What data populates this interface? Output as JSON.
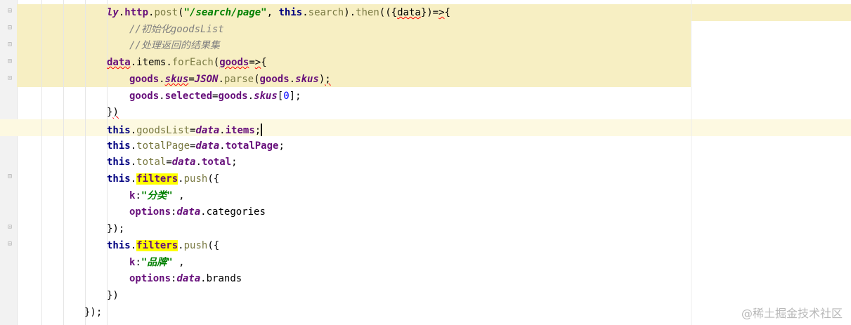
{
  "lines": [
    {
      "indent": 1,
      "tokens": [
        {
          "t": "ly",
          "c": "t-ital"
        },
        {
          "t": ".",
          "c": "t-plain"
        },
        {
          "t": "http",
          "c": "t-prop"
        },
        {
          "t": ".",
          "c": "t-plain"
        },
        {
          "t": "post",
          "c": "t-meth"
        },
        {
          "t": "(",
          "c": "t-plain"
        },
        {
          "t": "\"/search/page\"",
          "c": "t-str"
        },
        {
          "t": ", ",
          "c": "t-plain"
        },
        {
          "t": "this",
          "c": "t-kw"
        },
        {
          "t": ".",
          "c": "t-plain"
        },
        {
          "t": "search",
          "c": "t-meth"
        },
        {
          "t": ").",
          "c": "t-plain"
        },
        {
          "t": "then",
          "c": "t-meth"
        },
        {
          "t": "(({",
          "c": "t-plain"
        },
        {
          "t": "data",
          "c": "t-plain t-err"
        },
        {
          "t": "})=",
          "c": "t-plain"
        },
        {
          "t": ">",
          "c": "t-plain t-err"
        },
        {
          "t": "{",
          "c": "t-plain"
        }
      ]
    },
    {
      "indent": 2,
      "tokens": [
        {
          "t": "//初始化goodsList",
          "c": "t-cmt"
        }
      ]
    },
    {
      "indent": 2,
      "tokens": [
        {
          "t": "//处理返回的结果集",
          "c": "t-cmt"
        }
      ]
    },
    {
      "indent": 1,
      "tokens": [
        {
          "t": "data",
          "c": "t-prop t-err"
        },
        {
          "t": ".",
          "c": "t-plain"
        },
        {
          "t": "items",
          "c": "t-plain"
        },
        {
          "t": ".",
          "c": "t-plain"
        },
        {
          "t": "forEach",
          "c": "t-meth"
        },
        {
          "t": "(",
          "c": "t-plain"
        },
        {
          "t": "goods",
          "c": "t-prop t-err"
        },
        {
          "t": "=",
          "c": "t-plain"
        },
        {
          "t": ">",
          "c": "t-plain t-err"
        },
        {
          "t": "{",
          "c": "t-plain"
        }
      ]
    },
    {
      "indent": 2,
      "tokens": [
        {
          "t": "goods",
          "c": "t-prop"
        },
        {
          "t": ".",
          "c": "t-plain"
        },
        {
          "t": "skus",
          "c": "t-propi t-err"
        },
        {
          "t": "=",
          "c": "t-plain"
        },
        {
          "t": "JSON",
          "c": "t-ital"
        },
        {
          "t": ".",
          "c": "t-plain"
        },
        {
          "t": "parse",
          "c": "t-meth"
        },
        {
          "t": "(",
          "c": "t-plain"
        },
        {
          "t": "goods",
          "c": "t-prop"
        },
        {
          "t": ".",
          "c": "t-plain"
        },
        {
          "t": "skus",
          "c": "t-propi"
        },
        {
          "t": ")",
          "c": "t-plain"
        },
        {
          "t": ";",
          "c": "t-plain t-err"
        }
      ]
    },
    {
      "indent": 2,
      "tokens": [
        {
          "t": "goods",
          "c": "t-prop"
        },
        {
          "t": ".",
          "c": "t-plain"
        },
        {
          "t": "selected",
          "c": "t-prop"
        },
        {
          "t": "=",
          "c": "t-plain"
        },
        {
          "t": "goods",
          "c": "t-prop"
        },
        {
          "t": ".",
          "c": "t-plain"
        },
        {
          "t": "skus",
          "c": "t-propi"
        },
        {
          "t": "[",
          "c": "t-plain"
        },
        {
          "t": "0",
          "c": "t-num"
        },
        {
          "t": "];",
          "c": "t-plain"
        }
      ]
    },
    {
      "indent": 1,
      "tokens": [
        {
          "t": "}",
          "c": "t-plain"
        },
        {
          "t": ")",
          "c": "t-plain t-err"
        }
      ]
    },
    {
      "indent": 1,
      "tokens": [
        {
          "t": "this",
          "c": "t-kw"
        },
        {
          "t": ".",
          "c": "t-plain"
        },
        {
          "t": "goodsList",
          "c": "t-meth"
        },
        {
          "t": "=",
          "c": "t-plain"
        },
        {
          "t": "data",
          "c": "t-ital"
        },
        {
          "t": ".",
          "c": "t-plain"
        },
        {
          "t": "items",
          "c": "t-prop"
        },
        {
          "t": ";",
          "c": "t-plain"
        }
      ],
      "cursor": true
    },
    {
      "indent": 1,
      "tokens": [
        {
          "t": "this",
          "c": "t-kw"
        },
        {
          "t": ".",
          "c": "t-plain"
        },
        {
          "t": "totalPage",
          "c": "t-meth"
        },
        {
          "t": "=",
          "c": "t-plain"
        },
        {
          "t": "data",
          "c": "t-ital"
        },
        {
          "t": ".",
          "c": "t-plain"
        },
        {
          "t": "totalPage",
          "c": "t-prop"
        },
        {
          "t": ";",
          "c": "t-plain"
        }
      ]
    },
    {
      "indent": 1,
      "tokens": [
        {
          "t": "this",
          "c": "t-kw"
        },
        {
          "t": ".",
          "c": "t-plain"
        },
        {
          "t": "total",
          "c": "t-meth"
        },
        {
          "t": "=",
          "c": "t-plain"
        },
        {
          "t": "data",
          "c": "t-ital"
        },
        {
          "t": ".",
          "c": "t-plain"
        },
        {
          "t": "total",
          "c": "t-prop"
        },
        {
          "t": ";",
          "c": "t-plain"
        }
      ]
    },
    {
      "indent": 1,
      "tokens": [
        {
          "t": "this",
          "c": "t-kw"
        },
        {
          "t": ".",
          "c": "t-plain"
        },
        {
          "t": "filters",
          "c": "t-hlword"
        },
        {
          "t": ".",
          "c": "t-plain"
        },
        {
          "t": "push",
          "c": "t-meth"
        },
        {
          "t": "({",
          "c": "t-plain"
        }
      ]
    },
    {
      "indent": 2,
      "tokens": [
        {
          "t": "k",
          "c": "t-prop"
        },
        {
          "t": ":",
          "c": "t-plain"
        },
        {
          "t": "\"分类\"",
          "c": "t-str"
        },
        {
          "t": " ,",
          "c": "t-plain"
        }
      ]
    },
    {
      "indent": 2,
      "tokens": [
        {
          "t": "options",
          "c": "t-prop"
        },
        {
          "t": ":",
          "c": "t-plain"
        },
        {
          "t": "data",
          "c": "t-ital"
        },
        {
          "t": ".",
          "c": "t-plain"
        },
        {
          "t": "categories",
          "c": "t-plain"
        }
      ]
    },
    {
      "indent": 1,
      "tokens": [
        {
          "t": "});",
          "c": "t-plain"
        }
      ]
    },
    {
      "indent": 1,
      "tokens": [
        {
          "t": "this",
          "c": "t-kw"
        },
        {
          "t": ".",
          "c": "t-plain"
        },
        {
          "t": "filters",
          "c": "t-hlword"
        },
        {
          "t": ".",
          "c": "t-plain"
        },
        {
          "t": "push",
          "c": "t-meth"
        },
        {
          "t": "({",
          "c": "t-plain"
        }
      ]
    },
    {
      "indent": 2,
      "tokens": [
        {
          "t": "k",
          "c": "t-prop"
        },
        {
          "t": ":",
          "c": "t-plain"
        },
        {
          "t": "\"品牌\"",
          "c": "t-str"
        },
        {
          "t": " ,",
          "c": "t-plain"
        }
      ]
    },
    {
      "indent": 2,
      "tokens": [
        {
          "t": "options",
          "c": "t-prop"
        },
        {
          "t": ":",
          "c": "t-plain"
        },
        {
          "t": "data",
          "c": "t-ital"
        },
        {
          "t": ".",
          "c": "t-plain"
        },
        {
          "t": "brands",
          "c": "t-plain"
        }
      ]
    },
    {
      "indent": 1,
      "tokens": [
        {
          "t": "})",
          "c": "t-plain"
        }
      ]
    },
    {
      "indent": 0,
      "tokens": [
        {
          "t": "});",
          "c": "t-plain"
        }
      ]
    }
  ],
  "watermark": "@稀土掘金技术社区"
}
